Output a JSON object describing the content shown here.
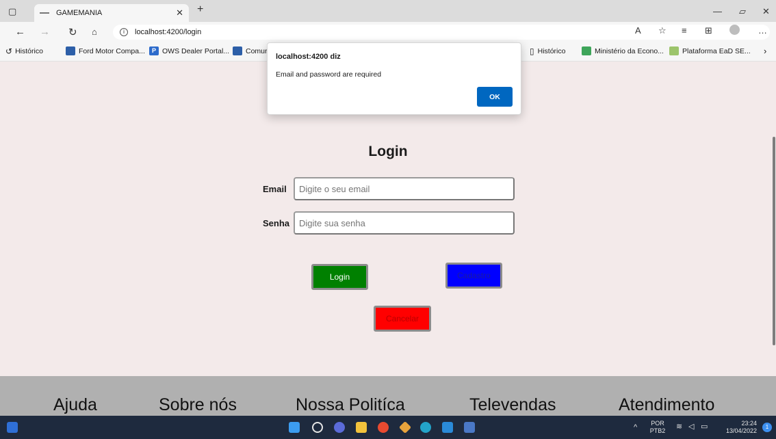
{
  "browser": {
    "tab_title": "GAMEMANIA",
    "url": "localhost:4200/login",
    "favorites": [
      {
        "label": "Histórico",
        "color": "#ffffff"
      },
      {
        "label": "Ford Motor Compa...",
        "color": "#2d5fa8"
      },
      {
        "label": "OWS Dealer Portal...",
        "color": "#2d6bcb"
      },
      {
        "label": "Comur",
        "color": "#2d5fa8"
      },
      {
        "label": "Histórico",
        "color": "#ffffff"
      },
      {
        "label": "Ministério da Econo...",
        "color": "#3ea55a"
      },
      {
        "label": "Plataforma EaD SE...",
        "color": "#9cc46b"
      }
    ]
  },
  "dialog": {
    "title": "localhost:4200 diz",
    "message": "Email and password are required",
    "ok_label": "OK"
  },
  "login": {
    "title": "Login",
    "email_label": "Email",
    "email_placeholder": "Digite o seu email",
    "password_label": "Senha",
    "password_placeholder": "Digite sua senha",
    "login_button": "Login",
    "signup_button": "Cadastro",
    "cancel_button": "Cancelar",
    "colors": {
      "login": "#008000",
      "signup": "#0000ff",
      "cancel": "#ff0000"
    }
  },
  "footer": {
    "items": [
      "Ajuda",
      "Sobre nós",
      "Nossa Politíca",
      "Televendas",
      "Atendimento"
    ]
  },
  "taskbar": {
    "language": "POR",
    "layout": "PTB2",
    "time": "23:24",
    "date": "13/04/2022",
    "notification_count": "1"
  }
}
